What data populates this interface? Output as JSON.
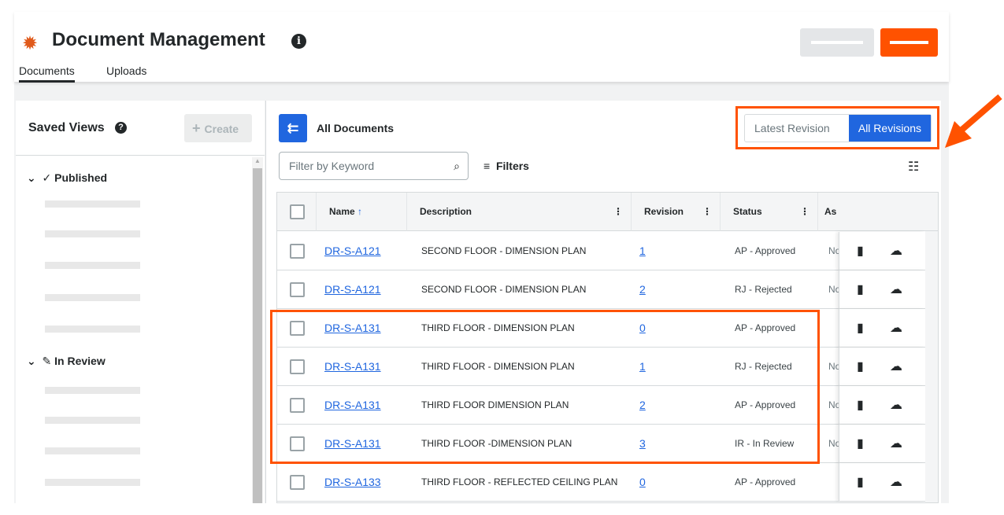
{
  "header": {
    "title": "Document Management",
    "tabs": [
      "Documents",
      "Uploads"
    ],
    "active_tab": "Documents"
  },
  "sidebar": {
    "title": "Saved Views",
    "create_label": "Create",
    "groups": [
      {
        "label": "Published"
      },
      {
        "label": "In Review"
      }
    ]
  },
  "main": {
    "breadcrumb": "All Documents",
    "toggle": {
      "options": [
        "Latest Revision",
        "All Revisions"
      ],
      "selected": "All Revisions"
    },
    "filter_placeholder": "Filter by Keyword",
    "filters_label": "Filters",
    "columns": [
      "Name",
      "Description",
      "Revision",
      "Status",
      "As"
    ],
    "rows": [
      {
        "name": "DR-S-A121",
        "description": "SECOND FLOOR - DIMENSION PLAN",
        "revision": "1",
        "status": "AP - Approved",
        "assignee": "No"
      },
      {
        "name": "DR-S-A121",
        "description": "SECOND FLOOR - DIMENSION PLAN",
        "revision": "2",
        "status": "RJ - Rejected",
        "assignee": "No"
      },
      {
        "name": "DR-S-A131",
        "description": "THIRD FLOOR - DIMENSION PLAN",
        "revision": "0",
        "status": "AP - Approved",
        "assignee": ""
      },
      {
        "name": "DR-S-A131",
        "description": "THIRD FLOOR - DIMENSION PLAN",
        "revision": "1",
        "status": "RJ - Rejected",
        "assignee": "No"
      },
      {
        "name": "DR-S-A131",
        "description": "THIRD FLOOR DIMENSION PLAN",
        "revision": "2",
        "status": "AP - Approved",
        "assignee": "No"
      },
      {
        "name": "DR-S-A131",
        "description": "THIRD FLOOR -DIMENSION PLAN",
        "revision": "3",
        "status": "IR - In Review",
        "assignee": "No"
      },
      {
        "name": "DR-S-A133",
        "description": "THIRD FLOOR - REFLECTED CEILING PLAN",
        "revision": "0",
        "status": "AP - Approved",
        "assignee": ""
      }
    ]
  },
  "colors": {
    "accent": "#ff5200",
    "primary": "#2066df",
    "highlight": "#ff5200"
  }
}
